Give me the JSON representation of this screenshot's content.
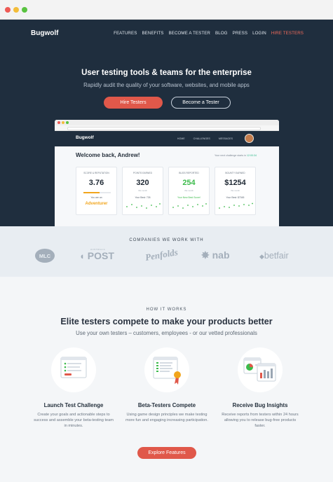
{
  "window": {
    "traffic_lights": [
      "#ee5a55",
      "#f3bd39",
      "#59c340"
    ]
  },
  "header": {
    "logo": "Bugwolf",
    "nav": [
      "FEATURES",
      "BENEFITS",
      "BECOME A TESTER",
      "BLOG",
      "PRESS",
      "LOGIN"
    ],
    "nav_cta": "HIRE TESTERS"
  },
  "hero": {
    "title": "User testing tools & teams for the enterprise",
    "subtitle": "Rapidly audit the quality of your software, websites, and mobile apps",
    "primary_button": "Hire Testers",
    "secondary_button": "Become a Tester"
  },
  "mockup": {
    "logo": "Bugwolf",
    "nav": [
      "HOME",
      "CHALLENGES",
      "MESSAGES"
    ],
    "welcome": "Welcome back, Andrew!",
    "streak_text": "Your next challenge starts in",
    "streak_time": "12:00:34",
    "cards": [
      {
        "label": "SCORE & REPUTATION",
        "value": "3.76",
        "note": "You are an",
        "rank": "Adventurer",
        "progress": 0.6
      },
      {
        "label": "POINTS EARNED",
        "value": "320",
        "sub": "this month",
        "note": "Your Best: 726"
      },
      {
        "label": "BUGS REPORTED",
        "value": "254",
        "sub": "this month",
        "note": "Your New Best Score!"
      },
      {
        "label": "BOUNTY EARNED",
        "value": "$1254",
        "sub": "this month",
        "note": "Your Best: $7045"
      }
    ]
  },
  "companies": {
    "title": "COMPANIES WE WORK WITH",
    "logos": [
      "MLC",
      "POST",
      "Penfolds",
      "nab",
      "betfair"
    ],
    "post_prefix": "AUSTRALIA"
  },
  "how": {
    "label": "HOW IT WORKS",
    "title": "Elite testers compete to make your products better",
    "subtitle": "Use your own testers – customers, employees - or our vetted professionals",
    "features": [
      {
        "icon": "checklist-icon",
        "title": "Launch Test Challenge",
        "desc": "Create your goals and actionable steps to success and assemble your beta-testing team in minutes."
      },
      {
        "icon": "award-ribbon-icon",
        "title": "Beta-Testers Compete",
        "desc": "Using game design principles we make testing more fun and engaging increasing participation."
      },
      {
        "icon": "report-charts-icon",
        "title": "Receive Bug Insights",
        "desc": "Receive reports from testers within 24 hours allowing you to release bug-free products faster."
      }
    ],
    "button": "Explore Features"
  },
  "colors": {
    "navy": "#1f2e3e",
    "accent": "#e0584a",
    "green": "#3dbb4c",
    "gold": "#f1a51c"
  }
}
